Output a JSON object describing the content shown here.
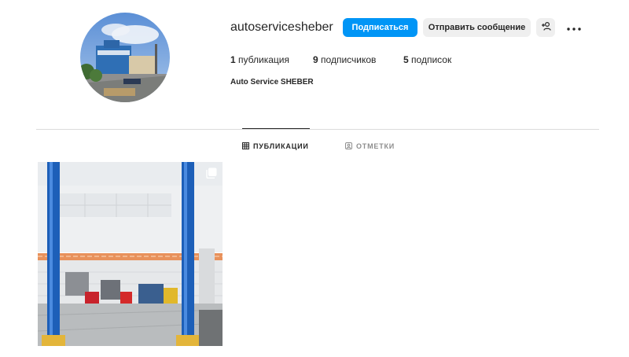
{
  "profile": {
    "username": "autoservicesheber",
    "full_name": "Auto Service SHEBER",
    "follow_label": "Подписаться",
    "message_label": "Отправить сообщение",
    "suggest_icon": "person-add-icon",
    "more_icon": "more-horizontal-icon"
  },
  "stats": {
    "posts_count": "1",
    "posts_label": "публикация",
    "followers_count": "9",
    "followers_label": "подписчиков",
    "following_count": "5",
    "following_label": "подписок"
  },
  "tabs": [
    {
      "label": "ПУБЛИКАЦИИ",
      "icon": "grid-icon",
      "active": true
    },
    {
      "label": "ОТМЕТКИ",
      "icon": "tagged-icon",
      "active": false
    }
  ],
  "posts": [
    {
      "type": "carousel",
      "icon": "multiple-photos-icon",
      "subject": "car service garage with blue lifts"
    }
  ],
  "colors": {
    "accent": "#0095f6",
    "secondary_button": "#efefef",
    "divider": "#dbdbdb",
    "muted_text": "#8e8e8e"
  }
}
